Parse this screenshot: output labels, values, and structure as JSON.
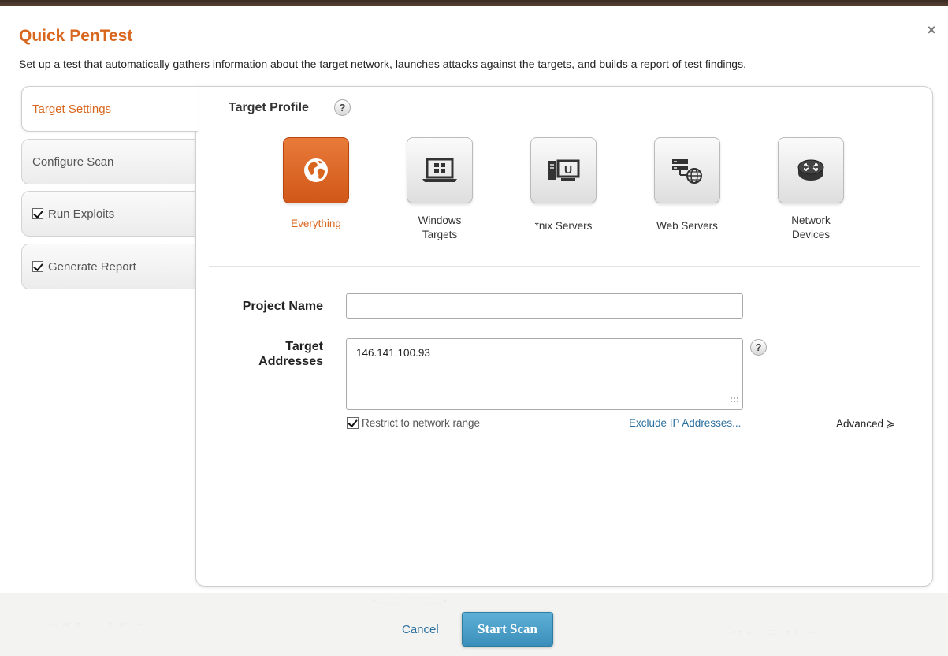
{
  "dialog": {
    "title": "Quick PenTest",
    "close_label": "×",
    "description": "Set up a test that automatically gathers information about the target network, launches attacks against the targets, and builds a report of test findings."
  },
  "tabs": [
    {
      "label": "Target Settings",
      "active": true,
      "checked": null
    },
    {
      "label": "Configure Scan",
      "active": false,
      "checked": null
    },
    {
      "label": "Run Exploits",
      "active": false,
      "checked": true
    },
    {
      "label": "Generate Report",
      "active": false,
      "checked": true
    }
  ],
  "target_profile": {
    "title": "Target Profile",
    "help": "?",
    "options": [
      {
        "label": "Everything",
        "icon": "globe-icon",
        "selected": true
      },
      {
        "label": "Windows\nTargets",
        "icon": "windows-laptop-icon",
        "selected": false
      },
      {
        "label": "*nix Servers",
        "icon": "unix-server-icon",
        "selected": false
      },
      {
        "label": "Web Servers",
        "icon": "web-server-icon",
        "selected": false
      },
      {
        "label": "Network\nDevices",
        "icon": "router-icon",
        "selected": false
      }
    ]
  },
  "form": {
    "project_name_label": "Project Name",
    "project_name_value": "",
    "target_addresses_label": "Target\nAddresses",
    "target_addresses_value": "146.141.100.93",
    "help": "?",
    "restrict_label": "Restrict to network range",
    "restrict_checked": true,
    "exclude_link": "Exclude IP Addresses...",
    "advanced_label": "Advanced ≽"
  },
  "footer": {
    "cancel_label": "Cancel",
    "start_label": "Start Scan"
  },
  "colors": {
    "accent": "#d9661e",
    "link": "#2a6f9e",
    "primary_button": "#4a9fca"
  }
}
